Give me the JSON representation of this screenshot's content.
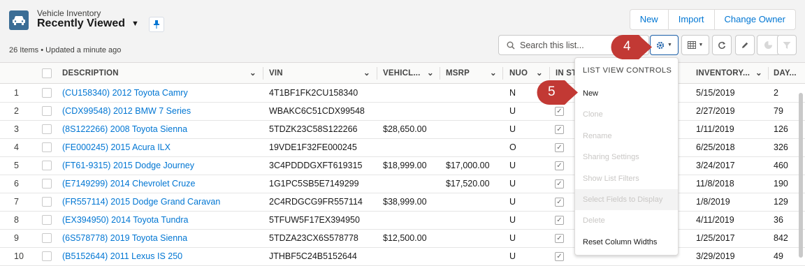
{
  "header": {
    "object_label": "Vehicle Inventory",
    "list_view": "Recently Viewed",
    "meta": "26 Items • Updated a minute ago"
  },
  "actions": {
    "new": "New",
    "import": "Import",
    "change_owner": "Change Owner"
  },
  "search": {
    "placeholder": "Search this list..."
  },
  "icons": {
    "object": "car-icon",
    "pin": "pin-icon",
    "search": "search-icon",
    "settings": "gear-icon",
    "display": "table-icon",
    "refresh": "refresh-icon",
    "edit": "pencil-icon",
    "charts": "pie-chart-icon",
    "filter": "filter-icon"
  },
  "columns": [
    {
      "label": "DESCRIPTION"
    },
    {
      "label": "VIN"
    },
    {
      "label": "VEHICL..."
    },
    {
      "label": "MSRP"
    },
    {
      "label": "NUO"
    },
    {
      "label": "IN ST"
    },
    {
      "label": "INVENTORY..."
    },
    {
      "label": "DAY..."
    }
  ],
  "rows": [
    {
      "n": "1",
      "desc": "(CU158340) 2012 Toyota Camry",
      "vin": "4T1BF1FK2CU158340",
      "price": "",
      "msrp": "",
      "nuo": "N",
      "checked": "",
      "date": "5/15/2019",
      "days": "2"
    },
    {
      "n": "2",
      "desc": "(CDX99548) 2012 BMW 7 Series",
      "vin": "WBAKC6C51CDX99548",
      "price": "",
      "msrp": "",
      "nuo": "U",
      "checked": "✓",
      "date": "2/27/2019",
      "days": "79"
    },
    {
      "n": "3",
      "desc": "(8S122266) 2008 Toyota Sienna",
      "vin": "5TDZK23C58S122266",
      "price": "$28,650.00",
      "msrp": "",
      "nuo": "U",
      "checked": "✓",
      "date": "1/11/2019",
      "days": "126"
    },
    {
      "n": "4",
      "desc": "(FE000245) 2015 Acura ILX",
      "vin": "19VDE1F32FE000245",
      "price": "",
      "msrp": "",
      "nuo": "O",
      "checked": "✓",
      "date": "6/25/2018",
      "days": "326"
    },
    {
      "n": "5",
      "desc": "(FT61-9315) 2015 Dodge Journey",
      "vin": "3C4PDDDGXFT619315",
      "price": "$18,999.00",
      "msrp": "$17,000.00",
      "nuo": "U",
      "checked": "✓",
      "date": "3/24/2017",
      "days": "460"
    },
    {
      "n": "6",
      "desc": "(E7149299) 2014 Chevrolet Cruze",
      "vin": "1G1PC5SB5E7149299",
      "price": "",
      "msrp": "$17,520.00",
      "nuo": "U",
      "checked": "✓",
      "date": "11/8/2018",
      "days": "190"
    },
    {
      "n": "7",
      "desc": "(FR557114) 2015 Dodge Grand Caravan",
      "vin": "2C4RDGCG9FR557114",
      "price": "$38,999.00",
      "msrp": "",
      "nuo": "U",
      "checked": "✓",
      "date": "1/8/2019",
      "days": "129"
    },
    {
      "n": "8",
      "desc": "(EX394950) 2014 Toyota Tundra",
      "vin": "5TFUW5F17EX394950",
      "price": "",
      "msrp": "",
      "nuo": "U",
      "checked": "✓",
      "date": "4/11/2019",
      "days": "36"
    },
    {
      "n": "9",
      "desc": "(6S578778) 2019 Toyota Sienna",
      "vin": "5TDZA23CX6S578778",
      "price": "$12,500.00",
      "msrp": "",
      "nuo": "U",
      "checked": "✓",
      "date": "1/25/2017",
      "days": "842"
    },
    {
      "n": "10",
      "desc": "(B5152644) 2011 Lexus IS 250",
      "vin": "JTHBF5C24B5152644",
      "price": "",
      "msrp": "",
      "nuo": "U",
      "checked": "✓",
      "date": "3/29/2019",
      "days": "49"
    }
  ],
  "dropdown": {
    "heading": "LIST VIEW CONTROLS",
    "items": [
      {
        "label": "New",
        "enabled": true
      },
      {
        "label": "Clone",
        "enabled": false
      },
      {
        "label": "Rename",
        "enabled": false
      },
      {
        "label": "Sharing Settings",
        "enabled": false
      },
      {
        "label": "Show List Filters",
        "enabled": false
      },
      {
        "label": "Select Fields to Display",
        "enabled": false
      },
      {
        "label": "Delete",
        "enabled": false
      },
      {
        "label": "Reset Column Widths",
        "enabled": true
      }
    ]
  },
  "callouts": {
    "step4": "4",
    "step5": "5"
  },
  "colors": {
    "link": "#0176d3",
    "callout": "#c23934",
    "object_icon": "#3b6d95"
  }
}
